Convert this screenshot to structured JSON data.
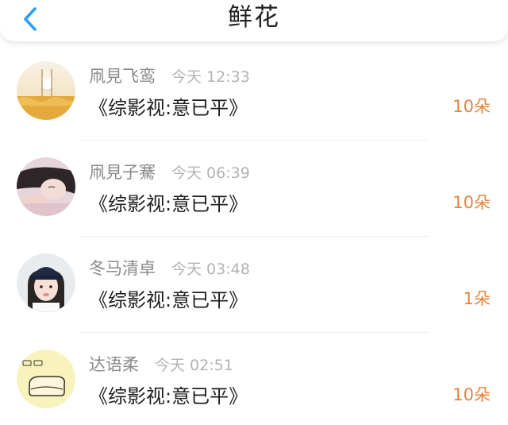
{
  "header": {
    "title": "鲜花",
    "back_icon": "chevron-left-icon",
    "accent_color": "#2f9ff2"
  },
  "flower_color": "#e8843a",
  "items": [
    {
      "name": "凧見飞鸾",
      "time": "今天 12:33",
      "book": "《综影视:意已平》",
      "count": "10朵",
      "avatar": "field-portrait"
    },
    {
      "name": "凧見子騫",
      "time": "今天 06:39",
      "book": "《综影视:意已平》",
      "count": "10朵",
      "avatar": "girl-lying-portrait"
    },
    {
      "name": "冬马清卓",
      "time": "今天 03:48",
      "book": "《综影视:意已平》",
      "count": "1朵",
      "avatar": "girl-cap-portrait"
    },
    {
      "name": "达语柔",
      "time": "今天 02:51",
      "book": "《综影视:意已平》",
      "count": "10朵",
      "avatar": "cartoon-bread-portrait"
    }
  ]
}
